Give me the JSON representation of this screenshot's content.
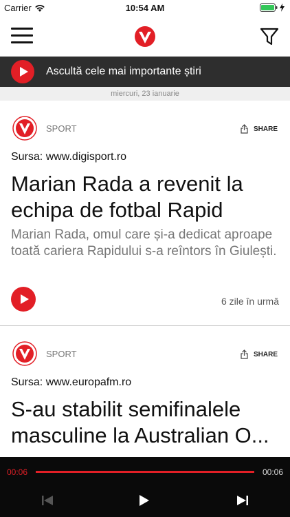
{
  "status_bar": {
    "carrier": "Carrier",
    "time": "10:54 AM"
  },
  "listen_bar": {
    "label": "Ascultă cele mai importante știri"
  },
  "date_label": "miercuri, 23 ianuarie",
  "articles": [
    {
      "category": "SPORT",
      "share_label": "SHARE",
      "source": "Sursa: www.digisport.ro",
      "title": "Marian Rada a revenit la echipa de fotbal Rapid",
      "summary": "Marian Rada, omul care și-a dedicat aproape toată cariera Rapidului s-a reîntors în Giulești.",
      "age": "6 zile în urmă"
    },
    {
      "category": "SPORT",
      "share_label": "SHARE",
      "source": "Sursa: www.europafm.ro",
      "title": "S-au stabilit semifinalele masculine la Australian O..."
    }
  ],
  "player": {
    "current_time": "00:06",
    "total_time": "00:06",
    "progress": 1.0
  },
  "colors": {
    "accent": "#e21f26",
    "listen_bar_bg": "#2e2e2e",
    "player_bg": "#0a0a0a"
  }
}
